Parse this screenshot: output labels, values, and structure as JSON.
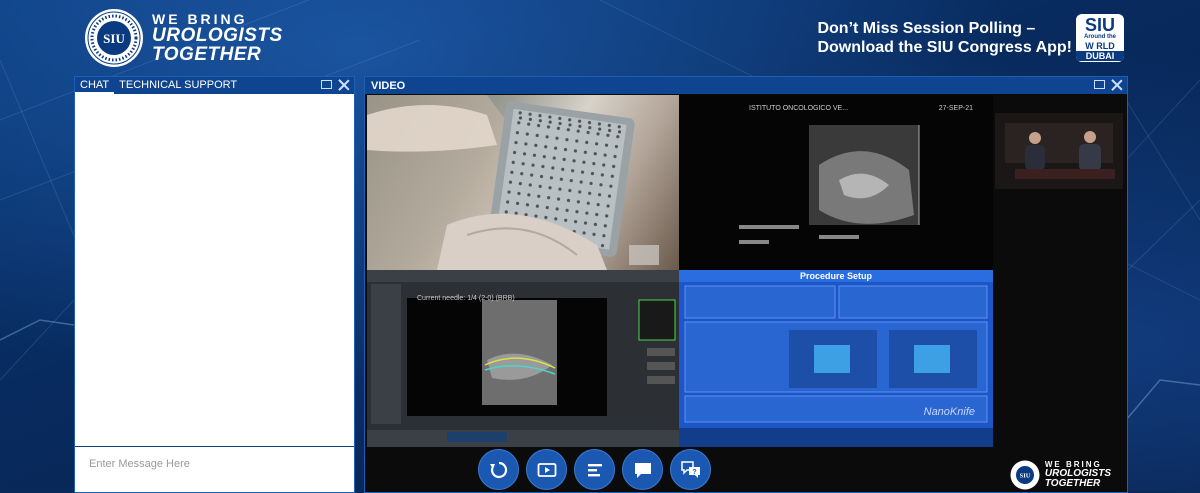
{
  "header": {
    "tagline_line1": "WE BRING",
    "tagline_line2": "UROLOGISTS",
    "tagline_line3": "TOGETHER",
    "logo_text": "SIU",
    "promo_line1": "Don’t Miss Session Polling –",
    "promo_line2": "Download the SIU Congress App!",
    "app_logo": {
      "l1": "SIU",
      "l2": "Around the",
      "l3": "W RLD",
      "l4": "DUBAI"
    }
  },
  "chat": {
    "tabs": [
      {
        "label": "CHAT"
      },
      {
        "label": "TECHNICAL SUPPORT"
      }
    ],
    "placeholder": "Enter Message Here"
  },
  "video": {
    "title": "VIDEO",
    "ultrasound_header": "ISTITUTO ONCOLOGICO VE...",
    "ultrasound_date": "27-SEP-21",
    "procedure_title": "Procedure Setup",
    "procedure_brand": "NanoKnife",
    "planner_title": "Current needle: 1/4 (2-0) (BRB)",
    "controls": [
      {
        "icon": "replay-icon"
      },
      {
        "icon": "video-icon"
      },
      {
        "icon": "agenda-icon"
      },
      {
        "icon": "chat-bubble-icon"
      },
      {
        "icon": "question-icon"
      }
    ],
    "watermark": {
      "line1": "WE BRING",
      "line2": "UROLOGISTS",
      "line3": "TOGETHER",
      "logo_text": "SIU"
    }
  },
  "colors": {
    "background": "#0a2a5c",
    "panel_header": "#0f4590",
    "button": "#1a58b2",
    "procedure_blue": "#1d56c8"
  }
}
